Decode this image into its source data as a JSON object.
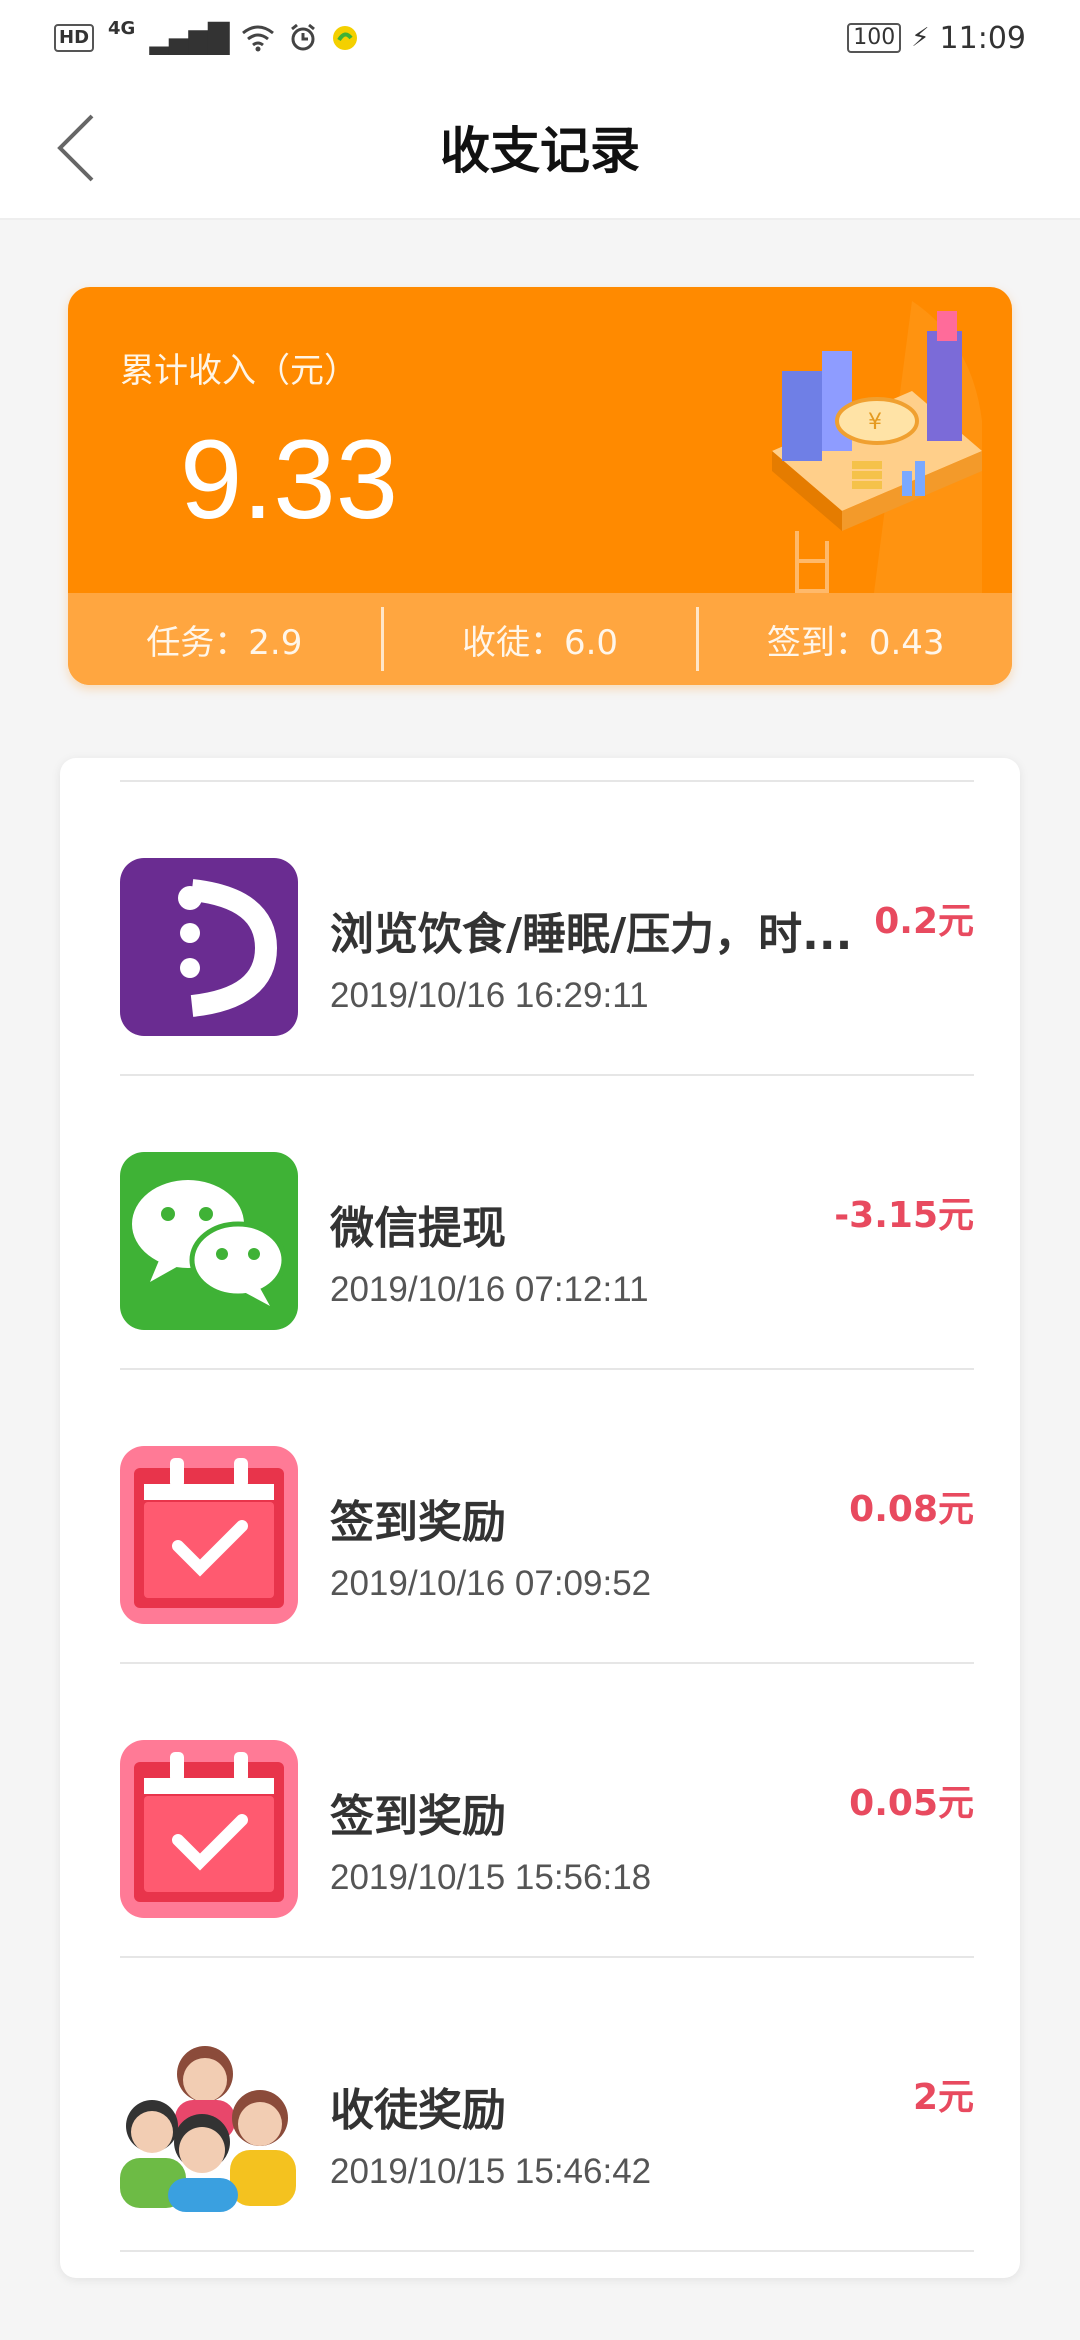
{
  "status_bar": {
    "hd": "HD",
    "network": "4G",
    "battery": "100",
    "time": "11:09"
  },
  "header": {
    "title": "收支记录"
  },
  "summary": {
    "label": "累计收入（元）",
    "total": "9.33",
    "stats": [
      {
        "text": "任务：2.9"
      },
      {
        "text": "收徒：6.0"
      },
      {
        "text": "签到：0.43"
      }
    ]
  },
  "records": [
    {
      "name": "浏览饮食/睡眠/压力，时...",
      "time": "2019/10/16 16:29:11",
      "amount": "0.2元",
      "icon": "purple-app-icon"
    },
    {
      "name": "微信提现",
      "time": "2019/10/16 07:12:11",
      "amount": "-3.15元",
      "icon": "wechat-icon"
    },
    {
      "name": "签到奖励",
      "time": "2019/10/16 07:09:52",
      "amount": "0.08元",
      "icon": "calendar-check-icon"
    },
    {
      "name": "签到奖励",
      "time": "2019/10/15 15:56:18",
      "amount": "0.05元",
      "icon": "calendar-check-icon"
    },
    {
      "name": "收徒奖励",
      "time": "2019/10/15 15:46:42",
      "amount": "2元",
      "icon": "people-group-icon"
    }
  ],
  "colors": {
    "accent_orange": "#ff8a00",
    "amount_red": "#e84a5f",
    "wechat_green": "#3fb236",
    "purple": "#6a2c91",
    "calendar_pink": "#ff7a96"
  }
}
